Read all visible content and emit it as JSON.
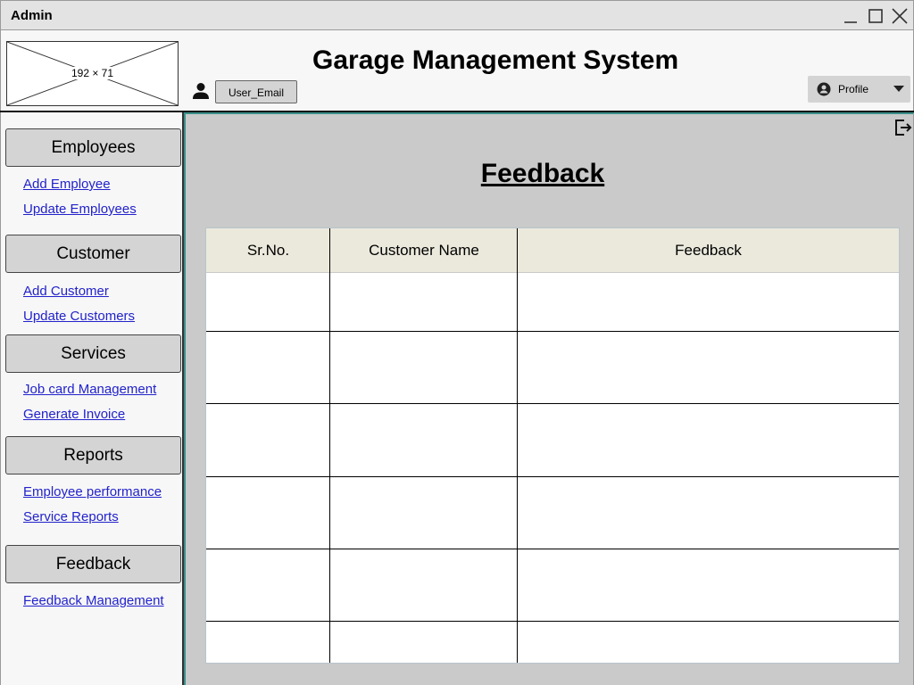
{
  "window": {
    "title": "Admin"
  },
  "header": {
    "logo_placeholder": "192 × 71",
    "app_title": "Garage Management System",
    "user_email": "User_Email",
    "profile_label": "Profile"
  },
  "sidebar": {
    "sections": [
      {
        "label": "Employees",
        "links": [
          "Add Employee",
          "Update Employees"
        ]
      },
      {
        "label": "Customer",
        "links": [
          "Add Customer",
          "Update Customers"
        ]
      },
      {
        "label": "Services",
        "links": [
          "Job card Management",
          "Generate Invoice"
        ]
      },
      {
        "label": "Reports",
        "links": [
          "Employee performance",
          "Service Reports"
        ]
      },
      {
        "label": "Feedback",
        "links": [
          "Feedback Management"
        ]
      }
    ]
  },
  "main": {
    "page_title": "Feedback",
    "table": {
      "columns": [
        "Sr.No.",
        "Customer Name",
        "Feedback"
      ],
      "rows": [
        [
          "",
          "",
          ""
        ],
        [
          "",
          "",
          ""
        ],
        [
          "",
          "",
          ""
        ],
        [
          "",
          "",
          ""
        ],
        [
          "",
          "",
          ""
        ],
        [
          "",
          "",
          ""
        ]
      ]
    }
  },
  "icons": {
    "minimize": "minimize-icon",
    "maximize": "maximize-icon",
    "close": "close-icon",
    "user": "user-icon",
    "profile": "account-circle-icon",
    "caret": "caret-down-icon",
    "logout": "logout-icon"
  },
  "colors": {
    "link": "#2222cc",
    "panel": "#cacaca",
    "table_header": "#ebe9dc",
    "accent_border": "#3a8f8a"
  }
}
